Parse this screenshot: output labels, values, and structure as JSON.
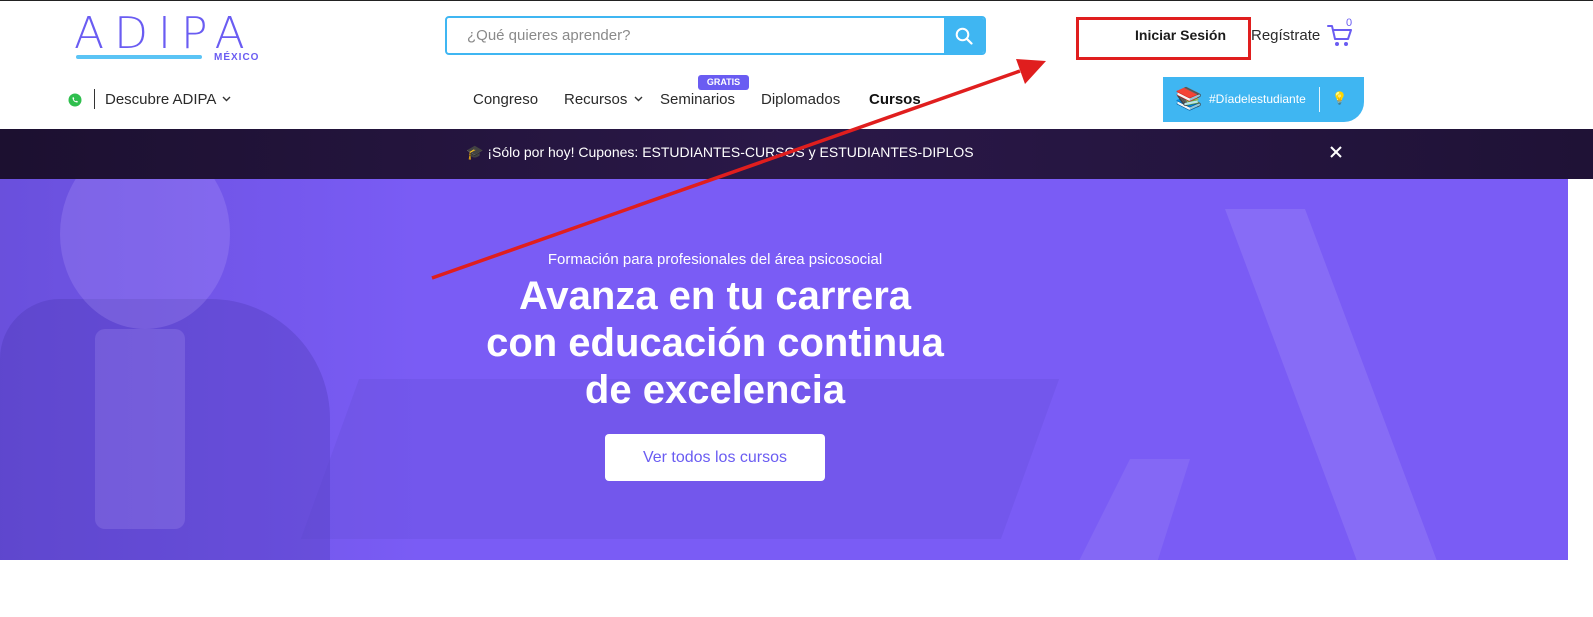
{
  "header": {
    "logo_text": "ADIPA",
    "logo_sub": "MÉXICO",
    "search": {
      "placeholder": "¿Qué quieres aprender?"
    },
    "login_label": "Iniciar Sesión",
    "register_label": "Regístrate",
    "cart_count": "0"
  },
  "nav": {
    "discover_label": "Descubre ADIPA",
    "items": [
      {
        "label": "Congreso"
      },
      {
        "label": "Recursos"
      },
      {
        "label": "Seminarios"
      },
      {
        "label": "Diplomados"
      },
      {
        "label": "Cursos"
      }
    ],
    "badge": "GRATIS",
    "promo_label": "#Díadelestudiante"
  },
  "announcement": {
    "text": "🎓 ¡Sólo por hoy! Cupones: ESTUDIANTES-CURSOS y ESTUDIANTES-DIPLOS"
  },
  "hero": {
    "subtitle": "Formación para profesionales del área psicosocial",
    "title_line1": "Avanza en tu carrera",
    "title_line2": "con educación continua",
    "title_line3": "de excelencia",
    "cta_label": "Ver todos los cursos"
  },
  "colors": {
    "brand_purple": "#6a5cf2",
    "accent_blue": "#3fb6f2",
    "hero_bg": "#7a5cf5",
    "announcement_bg": "#23153a",
    "annotation_red": "#e01e1e"
  },
  "icons": {
    "search": "search-icon",
    "cart": "cart-icon",
    "whatsapp": "whatsapp-icon",
    "close": "close-icon",
    "chevron": "chevron-down-icon",
    "books": "books-icon",
    "bulb": "lightbulb-icon"
  }
}
